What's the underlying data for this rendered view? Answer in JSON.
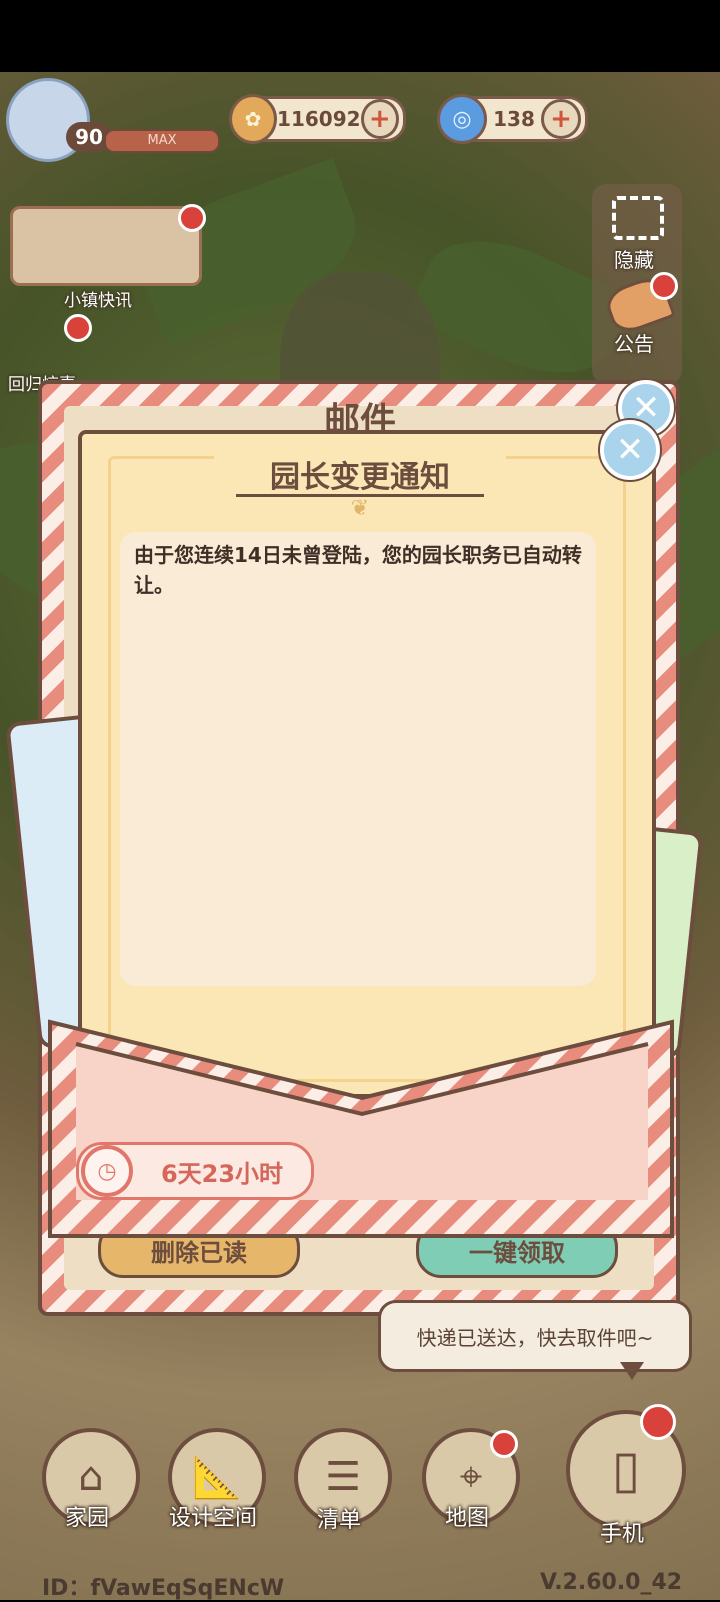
{
  "hud": {
    "level": "90",
    "level_status": "MAX",
    "coins": "116092",
    "gems": "138"
  },
  "left_menu": {
    "news_label": "小镇快讯",
    "return_label": "回归惊喜"
  },
  "side_menu": {
    "hide_label": "隐藏",
    "notice_label": "公告"
  },
  "mail_window": {
    "title": "邮件",
    "delete_read_label": "删除已读",
    "claim_all_label": "一键领取"
  },
  "letter": {
    "title": "园长变更通知",
    "body": "由于您连续14日未曾登陆，您的园长职务已自动转让。",
    "expiry": "6天23小时"
  },
  "speech_bubble": {
    "text": "快递已送达，快去取件吧~"
  },
  "bottom_nav": [
    {
      "label": "家园",
      "icon": "home-icon"
    },
    {
      "label": "设计空间",
      "icon": "ruler-icon"
    },
    {
      "label": "清单",
      "icon": "list-icon"
    },
    {
      "label": "地图",
      "icon": "map-pin-icon"
    },
    {
      "label": "手机",
      "icon": "phone-icon"
    }
  ],
  "footer": {
    "id_text": "ID：fVawEqSqENcW",
    "version": "V.2.60.0_42"
  },
  "colors": {
    "brown_outline": "#6d4e3e",
    "letter_bg": "#fbe7b6",
    "envelope_pink": "#f8d3c7",
    "stripe_red": "#e88c7e",
    "badge_red": "#d8423a"
  }
}
